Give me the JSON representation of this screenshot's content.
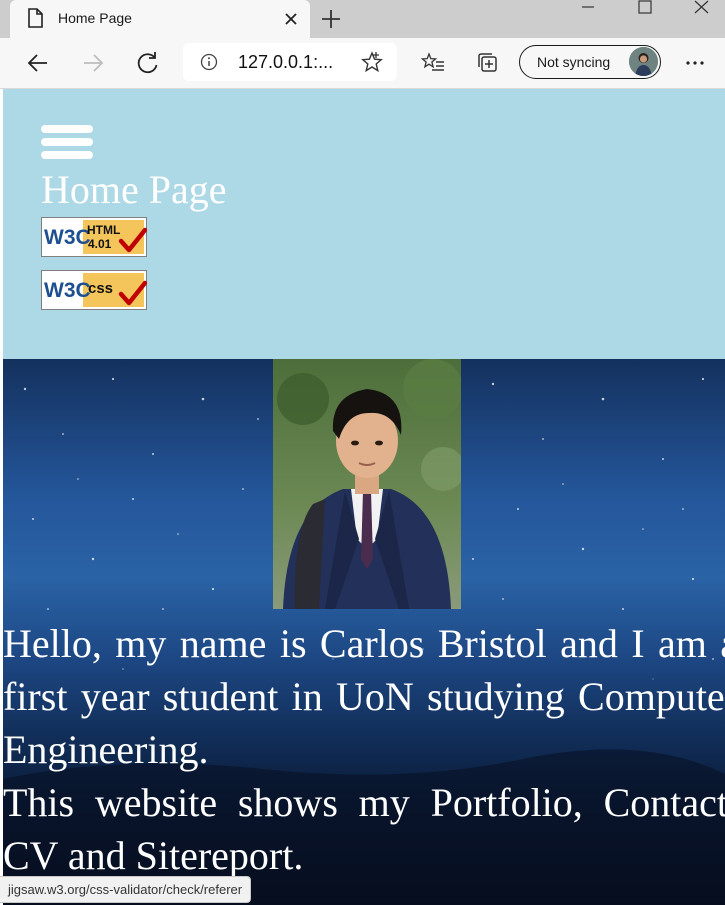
{
  "browser": {
    "tab_title": "Home Page",
    "url": "127.0.0.1:...",
    "sync_label": "Not syncing",
    "status_url": "jigsaw.w3.org/css-validator/check/referer",
    "icons": {
      "tab": "page-icon",
      "close": "close-icon",
      "new_tab": "plus-icon",
      "back": "back-arrow-icon",
      "forward": "forward-arrow-icon",
      "refresh": "refresh-icon",
      "info": "info-icon",
      "favorite": "star-icon",
      "favorites": "favorites-list-icon",
      "collections": "collections-icon",
      "menu": "more-icon"
    }
  },
  "page": {
    "header_bg": "#add8e6",
    "heading": "Home Page",
    "badges": [
      {
        "line1": "W3C",
        "line2": "HTML",
        "line3": "4.01"
      },
      {
        "line1": "W3C",
        "line2": "css",
        "line3": ""
      }
    ],
    "intro_line1": "Hello, my name is Carlos Bristol and I am a first year student in UoN studying Computer Engineering.",
    "intro_line2": "This website shows my Portfolio, Contact, CV and Sitereport."
  }
}
